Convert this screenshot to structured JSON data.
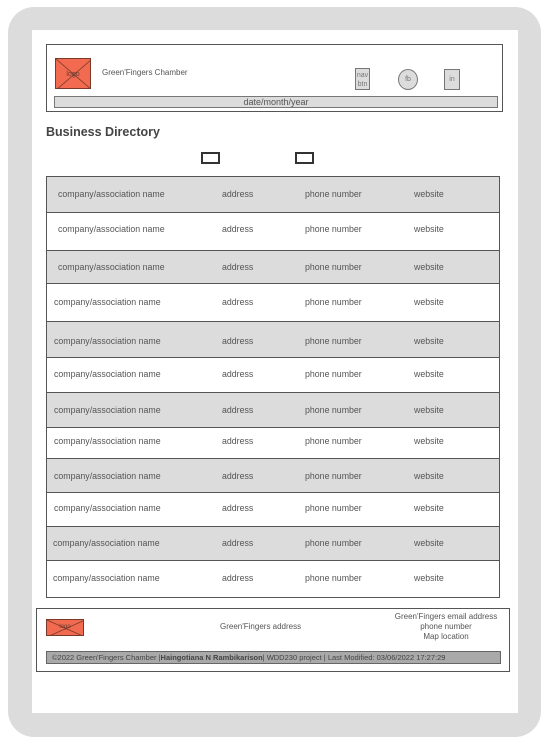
{
  "header": {
    "logo_label": "logo",
    "site_name": "Green'Fingers Chamber",
    "nav_button_label": "nav btn",
    "facebook_label": "fb",
    "linkedin_label": "in",
    "date_text": "date/month/year"
  },
  "directory": {
    "title": "Business Directory",
    "rows": [
      {
        "name": "company/association name",
        "address": "address",
        "phone": "phone number",
        "website": "website"
      },
      {
        "name": "company/association name",
        "address": "address",
        "phone": "phone number",
        "website": "website"
      },
      {
        "name": "company/association name",
        "address": "address",
        "phone": "phone number",
        "website": "website"
      },
      {
        "name": "company/association name",
        "address": "address",
        "phone": "phone number",
        "website": "website"
      },
      {
        "name": "company/association name",
        "address": "address",
        "phone": "phone number",
        "website": "website"
      },
      {
        "name": "company/association name",
        "address": "address",
        "phone": "phone number",
        "website": "website"
      },
      {
        "name": "company/association name",
        "address": "address",
        "phone": "phone number",
        "website": "website"
      },
      {
        "name": "company/association name",
        "address": "address",
        "phone": "phone number",
        "website": "website"
      },
      {
        "name": "company/association name",
        "address": "address",
        "phone": "phone number",
        "website": "website"
      },
      {
        "name": "company/association name",
        "address": "address",
        "phone": "phone number",
        "website": "website"
      },
      {
        "name": "company/association name",
        "address": "address",
        "phone": "phone number",
        "website": "website"
      },
      {
        "name": "company/association name",
        "address": "address",
        "phone": "phone number",
        "website": "website"
      }
    ]
  },
  "footer": {
    "logo_label": "logo",
    "address": "Green'Fingers address",
    "email": "Green'Fingers email address",
    "phone": "phone number",
    "map": "Map location",
    "copyright_prefix": "©2022 Green'Fingers Chamber |",
    "author": "Haingotiana N Rambikarison",
    "copyright_suffix": "| WDD230 project | Last Modified: 03/06/2022 17:27:29"
  },
  "colors": {
    "placeholder_red": "#f26b50",
    "shade_gray": "#dcdcdc"
  }
}
